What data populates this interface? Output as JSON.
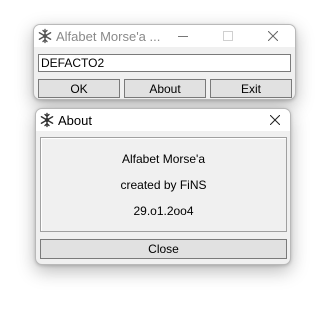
{
  "main_window": {
    "title": "Alfabet Morse'a ...",
    "input_value": "DEFACTO2",
    "buttons": {
      "ok": "OK",
      "about": "About",
      "exit": "Exit"
    },
    "icons": {
      "app": "snowflake-icon",
      "minimize": "minimize-icon",
      "maximize": "maximize-icon",
      "close": "close-icon"
    }
  },
  "about_dialog": {
    "title": "About",
    "lines": [
      "Alfabet Morse'a",
      "created by FiNS",
      "29.o1.2oo4"
    ],
    "close_button": "Close",
    "icons": {
      "app": "snowflake-icon",
      "close": "close-icon"
    }
  }
}
